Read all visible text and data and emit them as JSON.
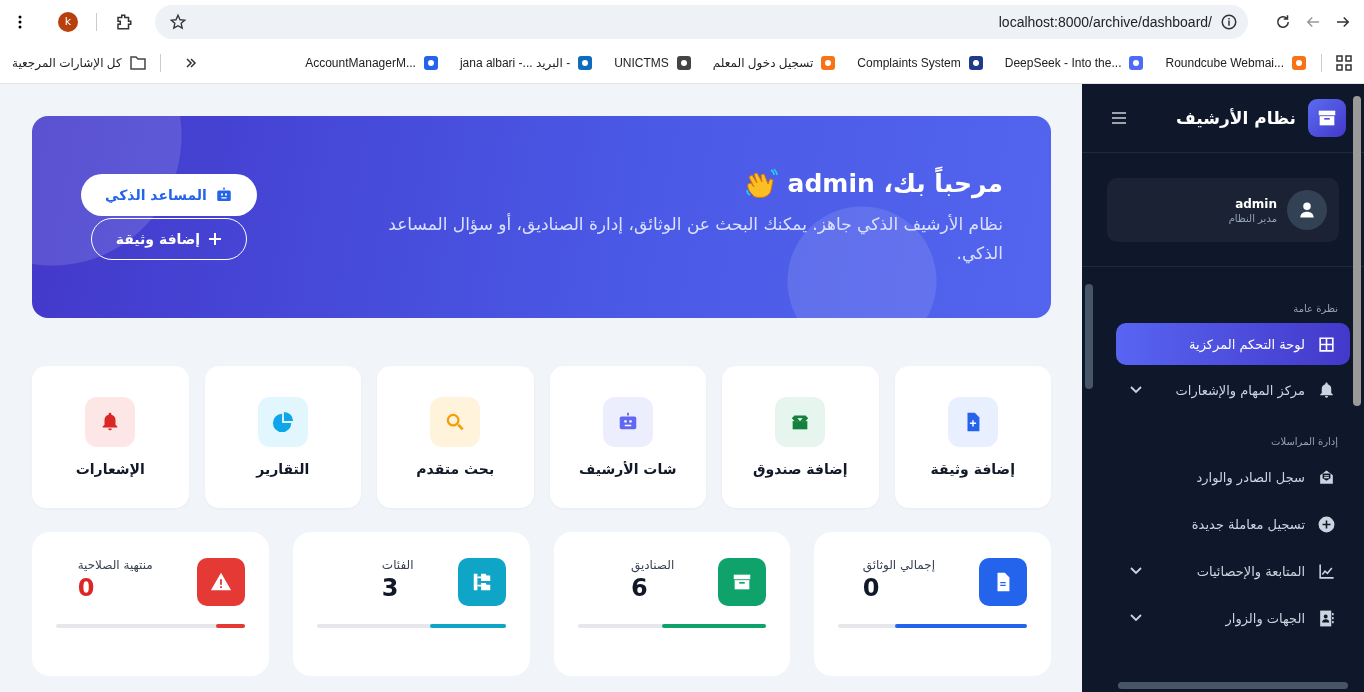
{
  "browser": {
    "profile_initial": "k",
    "url": "localhost:8000/archive/dashboard/",
    "bookmarks": [
      {
        "label": "Roundcube Webmai..."
      },
      {
        "label": "DeepSeek - Into the..."
      },
      {
        "label": "Complaints System"
      },
      {
        "label": "تسجيل دخول المعلم"
      },
      {
        "label": "UNICTMS"
      },
      {
        "label": "jana albari -... البريد -"
      },
      {
        "label": "AccountManagerM..."
      },
      {
        "label": "كل الإشارات المرجعية"
      }
    ]
  },
  "sidebar": {
    "title": "نظام الأرشيف",
    "user": {
      "name": "admin",
      "role": "مدير النظام"
    },
    "sections": [
      {
        "title": "نظرة عامة",
        "items": [
          {
            "label": "لوحة التحكم المركزية",
            "selected": true,
            "expandable": false
          },
          {
            "label": "مركز المهام والإشعارات",
            "selected": false,
            "expandable": true
          }
        ]
      },
      {
        "title": "إدارة المراسلات",
        "items": [
          {
            "label": "سجل الصادر والوارد",
            "selected": false,
            "expandable": false
          },
          {
            "label": "تسجيل معاملة جديدة",
            "selected": false,
            "expandable": false
          },
          {
            "label": "المتابعة والإحصائيات",
            "selected": false,
            "expandable": true
          },
          {
            "label": "الجهات والزوار",
            "selected": false,
            "expandable": true
          }
        ]
      }
    ]
  },
  "banner": {
    "title": "مرحباً بك، admin",
    "subtitle": "نظام الأرشيف الذكي جاهز. يمكنك البحث عن الوثائق، إدارة الصناديق، أو سؤال المساعد الذكي.",
    "assistant_button": "المساعد الذكي",
    "add_button": "إضافة وثيقة"
  },
  "quick_actions": [
    {
      "label": "إضافة وثيقة",
      "color": "#2563eb"
    },
    {
      "label": "إضافة صندوق",
      "color": "#15803d"
    },
    {
      "label": "شات الأرشيف",
      "color": "#6366f1"
    },
    {
      "label": "بحث متقدم",
      "color": "#f59e0b"
    },
    {
      "label": "التقارير",
      "color": "#0ea5e9"
    },
    {
      "label": "الإشعارات",
      "color": "#dc2626"
    }
  ],
  "stats": [
    {
      "label": "إجمالي الوثائق",
      "value": "0",
      "color": "#2463eb",
      "level": 0.7,
      "alert": false
    },
    {
      "label": "الصناديق",
      "value": "6",
      "color": "#0fa36b",
      "level": 0.55,
      "alert": false
    },
    {
      "label": "الفئات",
      "value": "3",
      "color": "#0ea5c6",
      "level": 0.4,
      "alert": false
    },
    {
      "label": "منتهية الصلاحية",
      "value": "0",
      "color": "#e53935",
      "level": 0.15,
      "alert": true
    }
  ]
}
